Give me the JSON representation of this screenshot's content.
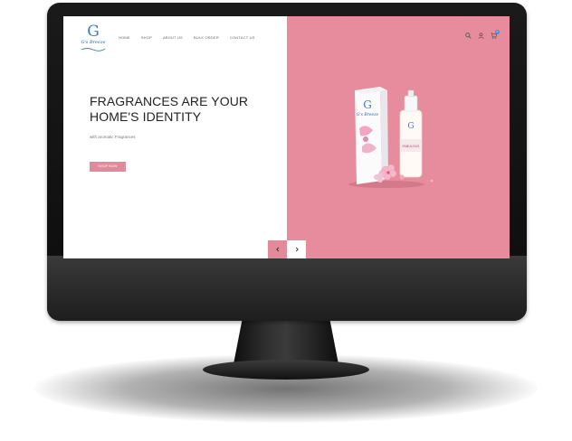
{
  "brand": {
    "logo_letter": "G",
    "logo_name": "G's Breeze"
  },
  "nav": {
    "items": [
      "HOME",
      "SHOP",
      "ABOUT US",
      "BULK ORDER",
      "CONTACT US"
    ]
  },
  "header": {
    "cart_count": "0"
  },
  "hero": {
    "title": "FRAGRANCES ARE YOUR HOME'S IDENTITY",
    "subtitle": "with aromatic Fragrances",
    "cta_label": "SHOP NOW"
  },
  "product": {
    "box_brand": "G's Breeze",
    "label": "FABULOUS"
  },
  "colors": {
    "accent_pink": "#e78c9c",
    "button_pink": "#e2899a",
    "logo_blue": "#3a7cc6",
    "monitor_black": "#111111"
  },
  "icons": [
    "search-icon",
    "user-icon",
    "cart-icon",
    "chevron-left-icon",
    "chevron-right-icon"
  ]
}
